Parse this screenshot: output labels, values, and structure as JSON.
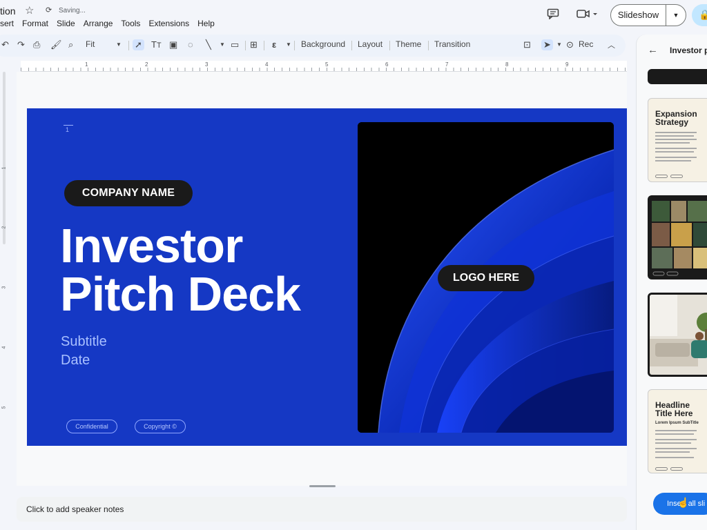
{
  "app": {
    "doc_title": "tion",
    "save_status": "Saving...",
    "menu": [
      "sert",
      "Format",
      "Slide",
      "Arrange",
      "Tools",
      "Extensions",
      "Help"
    ]
  },
  "header": {
    "slideshow_label": "Slideshow"
  },
  "toolbar": {
    "zoom": "Fit",
    "background": "Background",
    "layout": "Layout",
    "theme": "Theme",
    "transition": "Transition",
    "rec": "Rec"
  },
  "ruler": {
    "marks": [
      "1",
      "2",
      "3",
      "4",
      "5",
      "6",
      "7",
      "8",
      "9"
    ],
    "vmarks": [
      "1",
      "2",
      "3",
      "4",
      "5"
    ]
  },
  "slide": {
    "number": "1",
    "company": "COMPANY NAME",
    "title_line1": "Investor",
    "title_line2": "Pitch Deck",
    "subtitle": "Subtitle",
    "date": "Date",
    "confidential": "Confidential",
    "copyright": "Copyright ©",
    "logo": "LOGO HERE"
  },
  "notes": {
    "placeholder": "Click to add speaker notes"
  },
  "panel": {
    "title": "Investor p",
    "thumbs": [
      {
        "title_l1": "Expansion",
        "title_l2": "Strategy"
      },
      {
        "title_l1": "Headline",
        "title_l2": "Title Here",
        "sub": "Lorem Ipsum SubTitle"
      }
    ],
    "insert_label": "Insert all sli"
  },
  "colors": {
    "slide_bg": "#1538c4",
    "accent_blue": "#1a73e8",
    "pill_dark": "#1a1a1a"
  }
}
